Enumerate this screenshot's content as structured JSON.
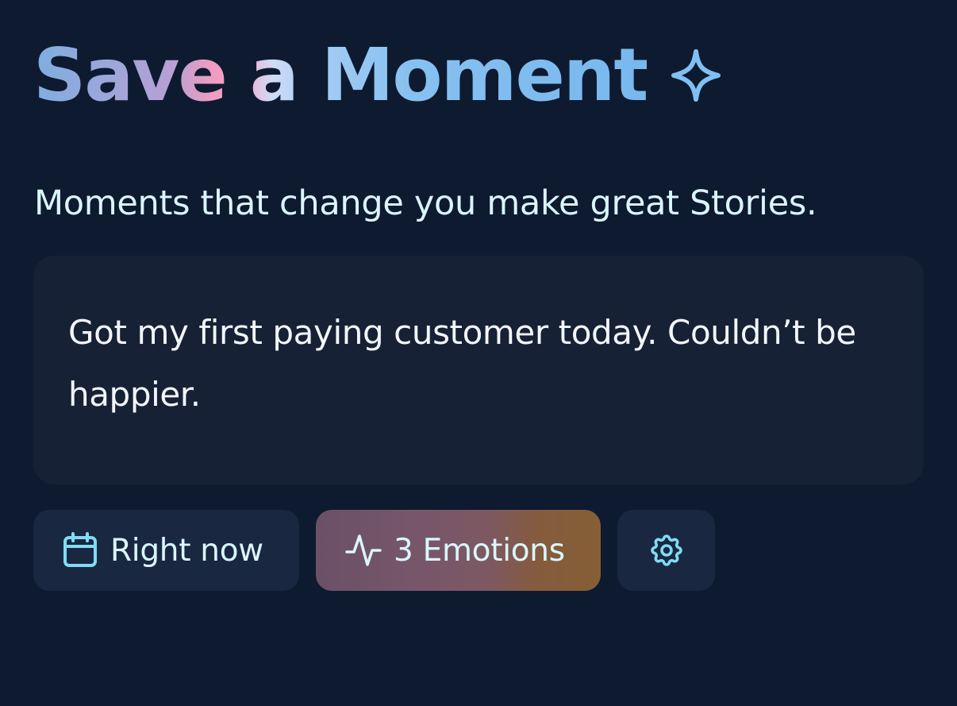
{
  "header": {
    "title": "Save a Moment",
    "title_icon": "sparkle-icon"
  },
  "subtitle": "Moments that change you make great Stories.",
  "moment": {
    "text": "Got my first paying customer today. Couldn’t be happier."
  },
  "chips": {
    "time": {
      "label": "Right now",
      "icon": "calendar-icon"
    },
    "emotions": {
      "label": "3 Emotions",
      "icon": "pulse-icon"
    },
    "settings": {
      "icon": "gear-icon"
    }
  },
  "colors": {
    "background": "#0e1a30",
    "card": "#172135",
    "chip": "#192741",
    "text_primary": "#f2f6ff",
    "text_accent": "#d9f6ff",
    "icon_cyan": "#7fdcf3",
    "title_blue": "#7eb8ee",
    "title_pink": "#f39cc2"
  }
}
